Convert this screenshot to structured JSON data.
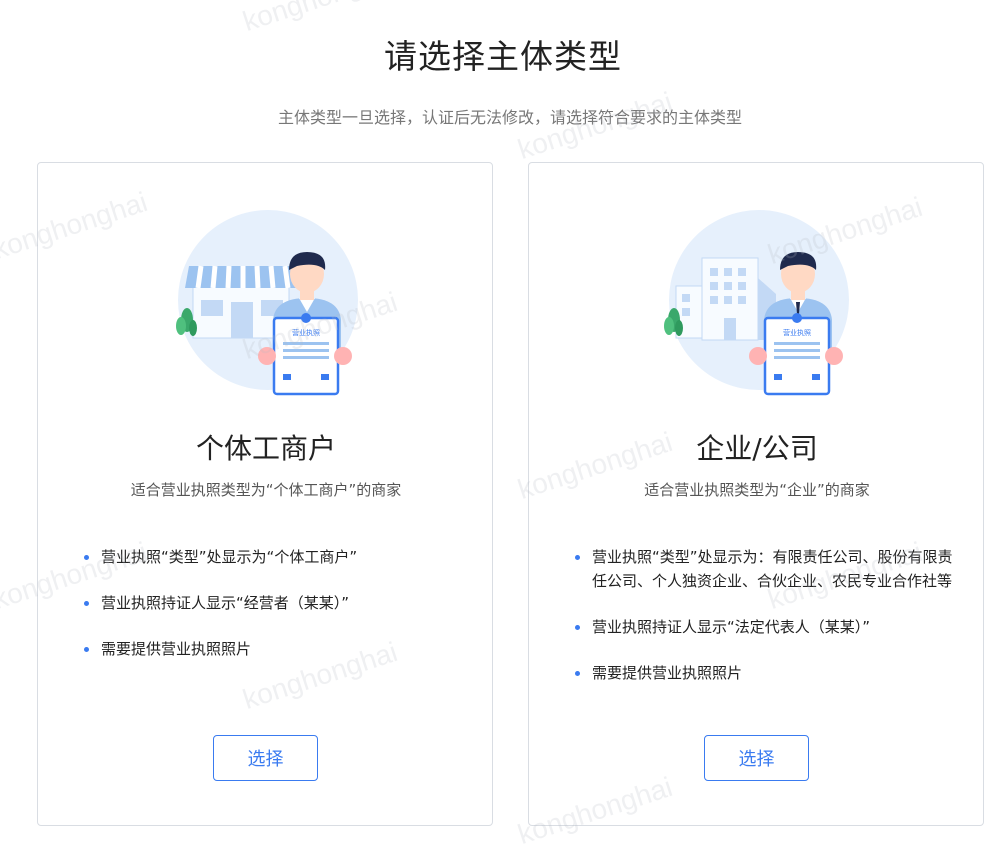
{
  "page": {
    "title": "请选择主体类型",
    "subtitle": "主体类型一旦选择，认证后无法修改，请选择符合要求的主体类型"
  },
  "watermark": "konghonghai",
  "cards": [
    {
      "title": "个体工商户",
      "description": "适合营业执照类型为“个体工商户”的商家",
      "badge_text": "营业执照",
      "bullets": [
        "营业执照“类型”处显示为“个体工商户”",
        "营业执照持证人显示“经营者（某某）”",
        "需要提供营业执照照片"
      ],
      "button_label": "选择"
    },
    {
      "title": "企业/公司",
      "description": "适合营业执照类型为“企业”的商家",
      "badge_text": "营业执照",
      "bullets": [
        "营业执照“类型”处显示为：有限责任公司、股份有限责任公司、个人独资企业、合伙企业、农民专业合作社等",
        "营业执照持证人显示“法定代表人（某某）”",
        "需要提供营业执照照片"
      ],
      "button_label": "选择"
    }
  ],
  "colors": {
    "accent": "#3a7bf0",
    "circle": "#e6f0fc",
    "hair": "#1f2a4d",
    "skin": "#ffd9c4",
    "shirt": "#9cc3f0",
    "plant": "#3aa86b",
    "building": "#c3d9f5"
  }
}
